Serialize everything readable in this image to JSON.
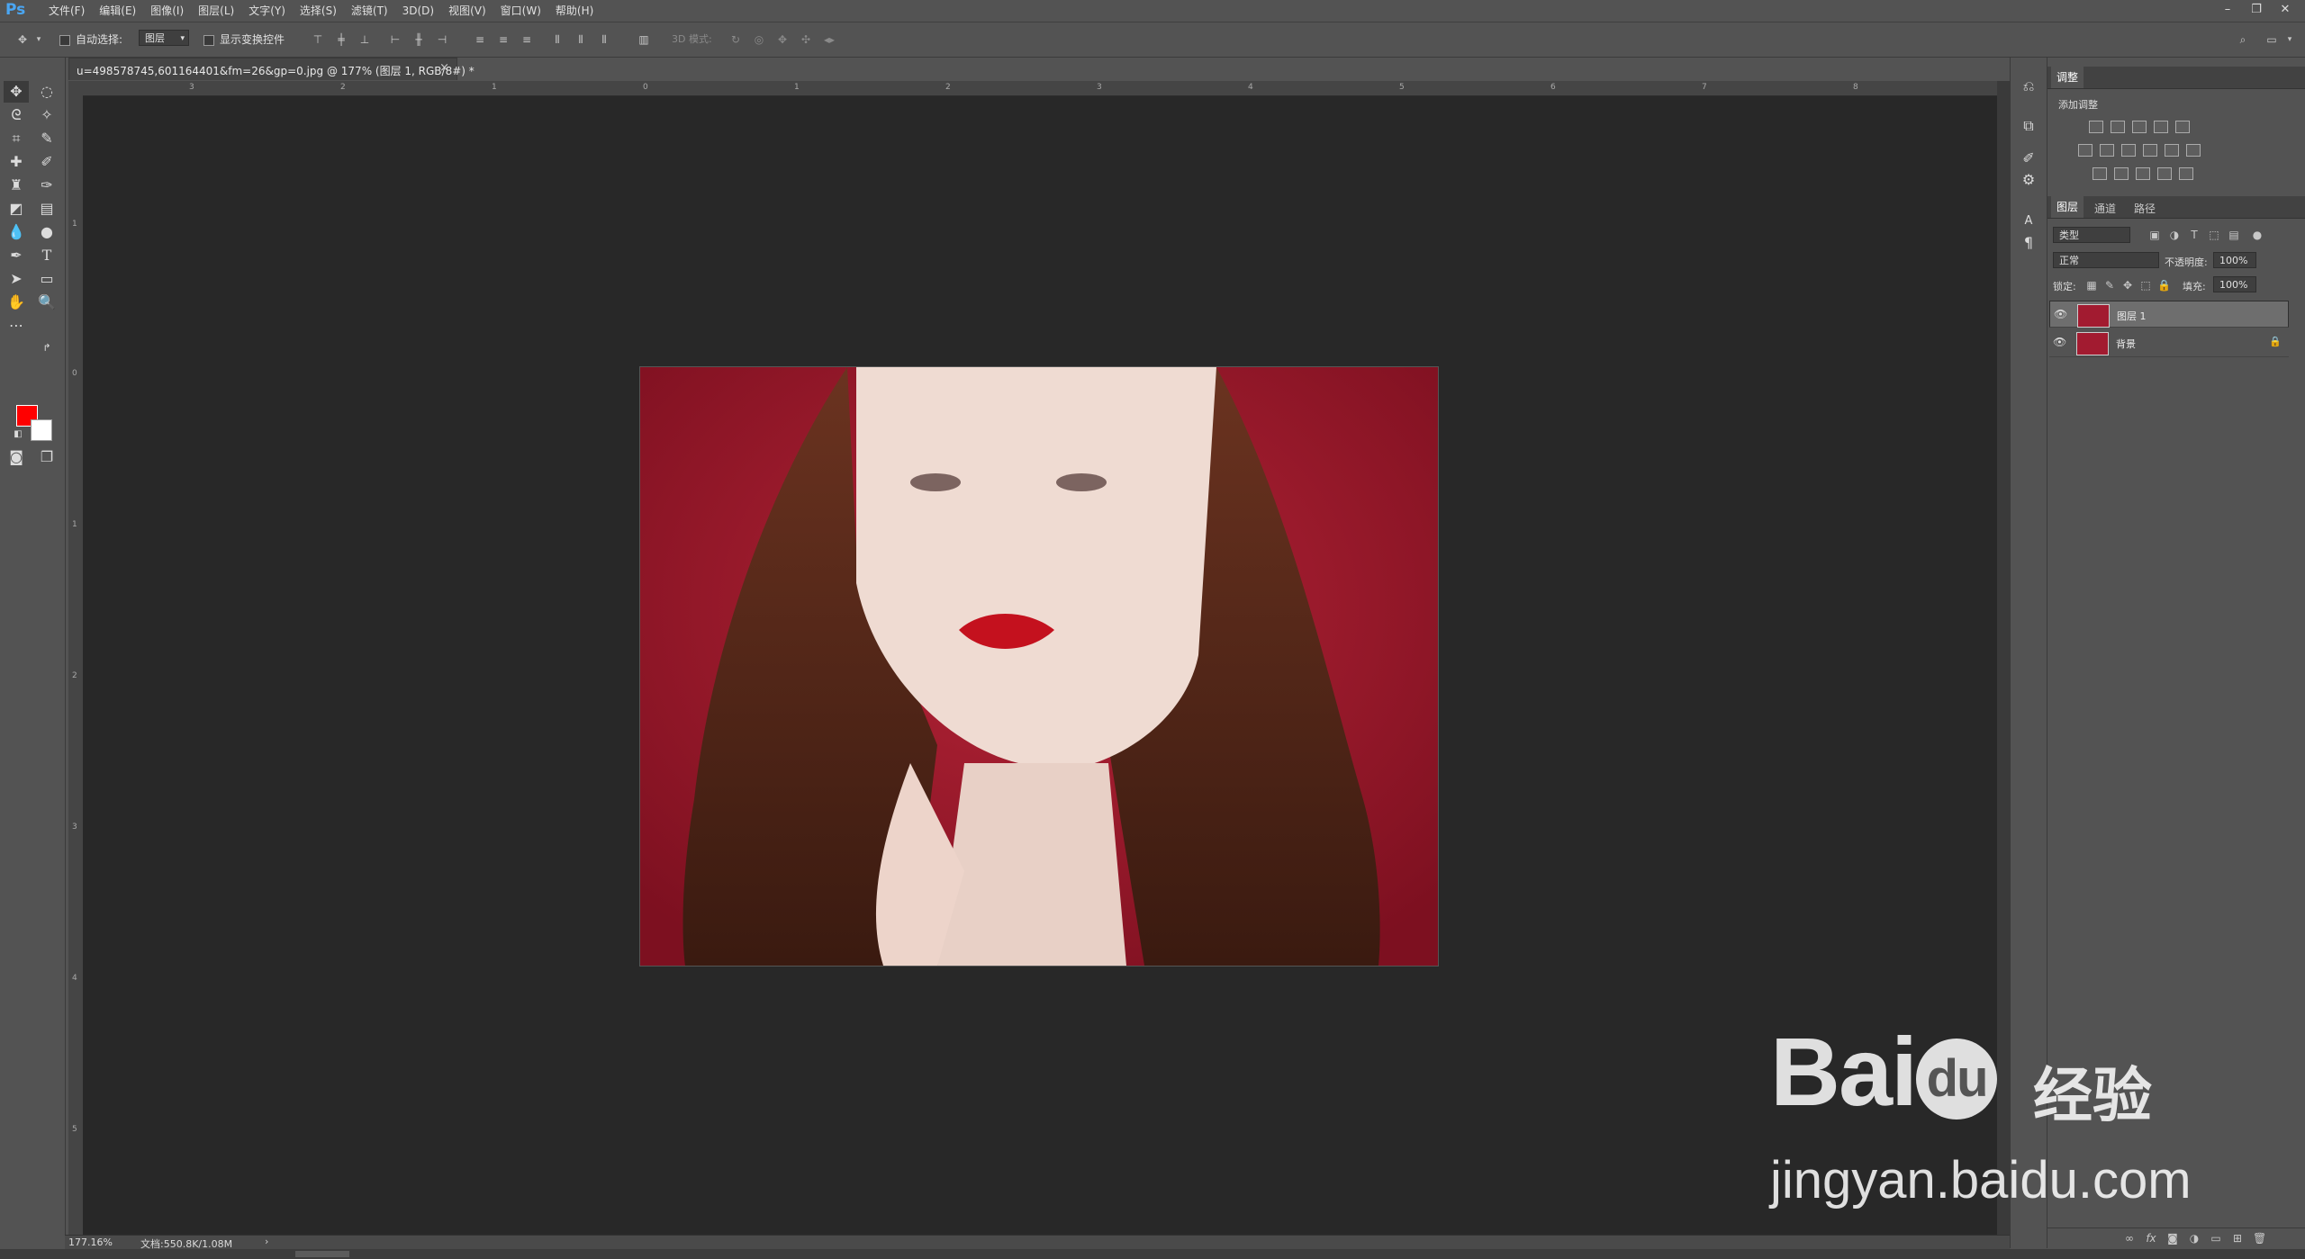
{
  "app": {
    "logo": "Ps"
  },
  "menu": {
    "items": [
      "文件(F)",
      "编辑(E)",
      "图像(I)",
      "图层(L)",
      "文字(Y)",
      "选择(S)",
      "滤镜(T)",
      "3D(D)",
      "视图(V)",
      "窗口(W)",
      "帮助(H)"
    ]
  },
  "window_controls": {
    "minimize": "–",
    "restore": "❐",
    "close": "✕"
  },
  "options": {
    "auto_select_label": "自动选择:",
    "auto_select_value": "图层",
    "show_transform_label": "显示变换控件",
    "mode_3d_label": "3D 模式:"
  },
  "document": {
    "tab_title": "u=498578745,601164401&fm=26&gp=0.jpg @ 177% (图层 1, RGB/8#) *",
    "close_glyph": "×",
    "zoom": "177.16%",
    "doc_size": "文档:550.8K/1.08M",
    "status_arrow": "›"
  },
  "rulers": {
    "h_ticks": [
      "3",
      "2",
      "1",
      "0",
      "1",
      "2",
      "3",
      "4",
      "5",
      "6",
      "7",
      "8"
    ],
    "v_ticks": [
      "1",
      "0",
      "1",
      "2",
      "3",
      "4",
      "5"
    ]
  },
  "panels": {
    "adjustments": {
      "tab": "调整",
      "add_label": "添加调整"
    },
    "layers": {
      "tabs": [
        "图层",
        "通道",
        "路径"
      ],
      "filter_kind": "类型",
      "blend_mode": "正常",
      "opacity_label": "不透明度:",
      "opacity_value": "100%",
      "lock_label": "锁定:",
      "fill_label": "填充:",
      "fill_value": "100%",
      "rows": [
        {
          "name": "图层 1",
          "selected": true,
          "locked": false
        },
        {
          "name": "背景",
          "selected": false,
          "locked": true
        }
      ]
    }
  },
  "colors": {
    "foreground": "#ff0000",
    "background": "#ffffff",
    "canvas_bg": "#282828",
    "ui_bg": "#535353"
  },
  "watermark": {
    "brand": "Bai",
    "brand_suffix": "du",
    "cn": "经验",
    "url": "jingyan.baidu.com"
  }
}
